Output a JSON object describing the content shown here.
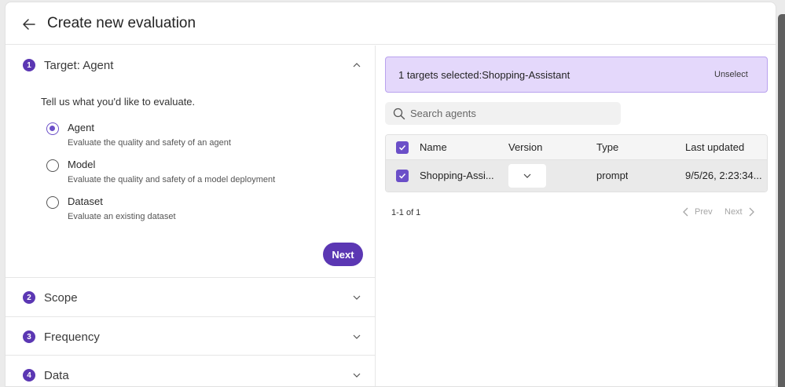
{
  "header": {
    "title": "Create new evaluation",
    "back_icon": "arrow-left-icon"
  },
  "steps": [
    {
      "number": "1",
      "label": "Target: Agent",
      "expanded": true
    },
    {
      "number": "2",
      "label": "Scope",
      "expanded": false
    },
    {
      "number": "3",
      "label": "Frequency",
      "expanded": false
    },
    {
      "number": "4",
      "label": "Data",
      "expanded": false
    }
  ],
  "target": {
    "prompt": "Tell us what you'd like to evaluate.",
    "options": [
      {
        "label": "Agent",
        "description": "Evaluate the quality and safety of an agent",
        "selected": true
      },
      {
        "label": "Model",
        "description": "Evaluate the quality and safety of a model deployment",
        "selected": false
      },
      {
        "label": "Dataset",
        "description": "Evaluate an existing dataset",
        "selected": false
      }
    ],
    "next_label": "Next"
  },
  "selection": {
    "banner_text": "1 targets selected:Shopping-Assistant",
    "unselect_label": "Unselect"
  },
  "search": {
    "placeholder": "Search agents",
    "value": ""
  },
  "table": {
    "columns": [
      "Name",
      "Version",
      "Type",
      "Last updated"
    ],
    "rows": [
      {
        "name": "Shopping-Assi...",
        "version": "",
        "type": "prompt",
        "last_updated": "9/5/26, 2:23:34...",
        "checked": true
      }
    ],
    "header_checked": true
  },
  "pagination": {
    "count": "1-1 of 1",
    "prev_label": "Prev",
    "next_label": "Next"
  },
  "colors": {
    "accent": "#5b37b3",
    "banner_bg": "#e4d8fb",
    "banner_border": "#b9a2ee"
  }
}
